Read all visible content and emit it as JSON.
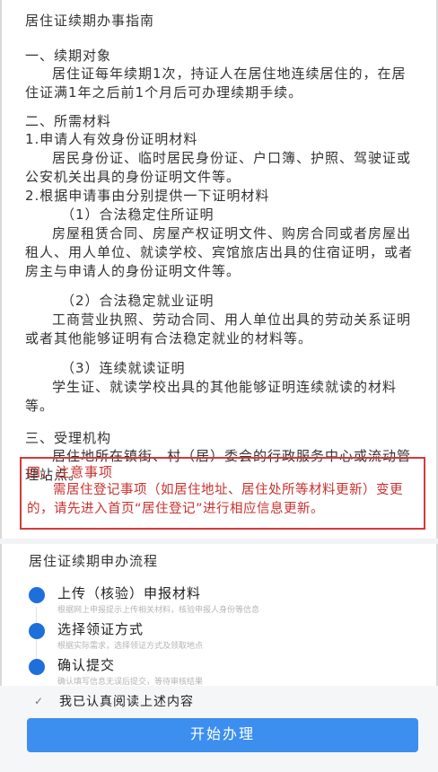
{
  "page": {
    "title": "居住证续期办事指南"
  },
  "section1": {
    "head": "一、续期对象",
    "text": "居住证每年续期1次，持证人在居住地连续居住的，在居住证满1年之后前1个月后可办理续期手续。"
  },
  "section2": {
    "head": "二、所需材料",
    "item1_title": "1.申请人有效身份证明材料",
    "item1_text": "居民身份证、临时居民身份证、户口簿、护照、驾驶证或公安机关出具的身份证明文件等。",
    "item2_title": "2.根据申请事由分别提供一下证明材料",
    "sub1_title": "（1）合法稳定住所证明",
    "sub1_text": "房屋租赁合同、房屋产权证明文件、购房合同或者房屋出租人、用人单位、就读学校、宾馆旅店出具的住宿证明，或者房主与申请人的身份证明文件等。",
    "sub2_title": "（2）合法稳定就业证明",
    "sub2_text": "工商营业执照、劳动合同、用人单位出具的劳动关系证明或者其他能够证明有合法稳定就业的材料等。",
    "sub3_title": "（3）连续就读证明",
    "sub3_text": "学生证、就读学校出具的其他能够证明连续就读的材料等。"
  },
  "section3": {
    "head": "三、受理机构",
    "text": "居住地所在镇街、村（居）委会的行政服务中心或流动管理站点。"
  },
  "notice": {
    "head": "四、注意事项",
    "text": "需居住登记事项（如居住地址、居住处所等材料更新）变更的，请先进入首页“居住登记”进行相应信息更新。"
  },
  "flow": {
    "title": "居住证续期申办流程",
    "steps": [
      {
        "label": "上传（核验）申报材料",
        "desc": "根据网上申报提示上传相关材料，核验申报人身份等信息"
      },
      {
        "label": "选择领证方式",
        "desc": "根据实际需求，选择领证方式及领取地点"
      },
      {
        "label": "确认提交",
        "desc": "确认填写信息无误后提交，等待审核结果"
      }
    ]
  },
  "footer": {
    "agree_text": "我已认真阅读上述内容",
    "start_button": "开始办理"
  },
  "colors": {
    "accent": "#3c8eef",
    "dot": "#1e6fdc",
    "notice": "#c8322e"
  }
}
